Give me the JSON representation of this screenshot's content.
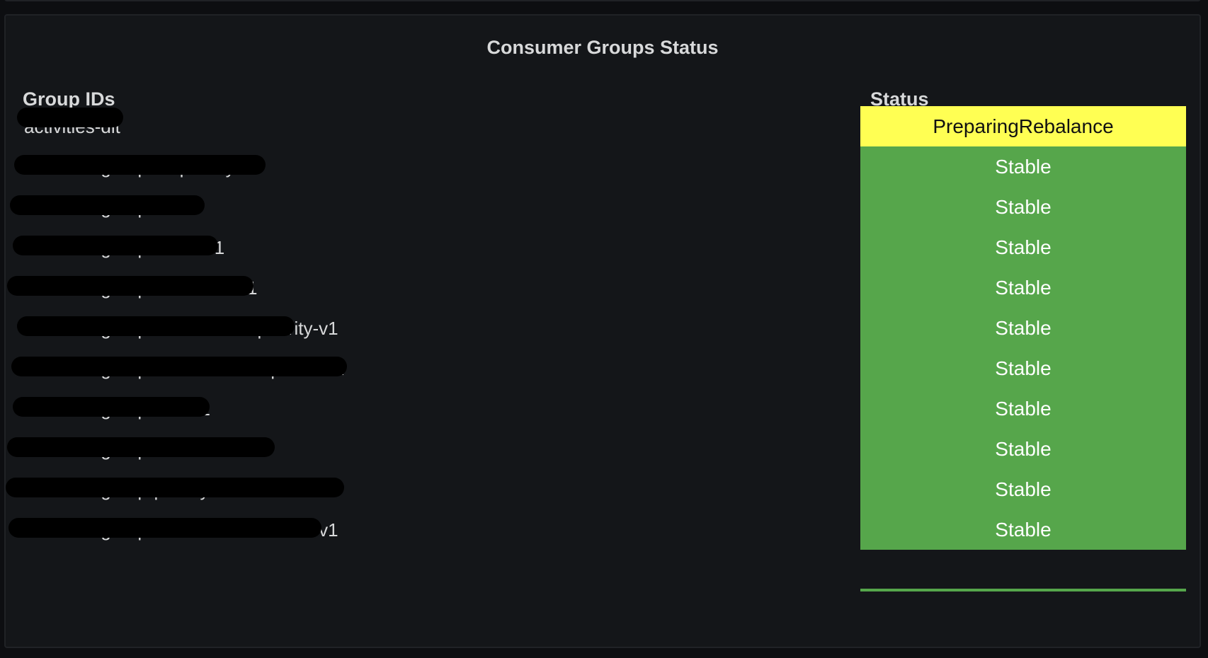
{
  "panel": {
    "title": "Consumer Groups Status"
  },
  "columns": {
    "group_ids": "Group IDs",
    "status": "Status"
  },
  "colors": {
    "stable": "#56a64b",
    "preparing_rebalance": "#ffff53",
    "background": "#141619",
    "text": "#d8d9da"
  },
  "rows": [
    {
      "group_id": "activities-dlt",
      "status": "PreparingRebalance",
      "status_color": "#ffff53",
      "status_text_color": "#111111"
    },
    {
      "group_id": "activities-group-dlt-priority-v1",
      "status": "Stable",
      "status_color": "#56a64b",
      "status_text_color": "#ffffff"
    },
    {
      "group_id": "activities-group-dlt-v1",
      "status": "Stable",
      "status_color": "#56a64b",
      "status_text_color": "#ffffff"
    },
    {
      "group_id": "activities-group-alerts-v1",
      "status": "Stable",
      "status_color": "#56a64b",
      "status_text_color": "#ffffff"
    },
    {
      "group_id": "activities-group-userflows-v1",
      "status": "Stable",
      "status_color": "#56a64b",
      "status_text_color": "#ffffff"
    },
    {
      "group_id": "activities-group-notifications-priority-v1",
      "status": "Stable",
      "status_color": "#56a64b",
      "status_text_color": "#ffffff"
    },
    {
      "group_id": "activities-group-notification-requests-v1",
      "status": "Stable",
      "status_color": "#56a64b",
      "status_text_color": "#ffffff"
    },
    {
      "group_id": "activities-group-rain-v1",
      "status": "Stable",
      "status_color": "#56a64b",
      "status_text_color": "#ffffff"
    },
    {
      "group_id": "activities-group-socialflows-v1",
      "status": "Stable",
      "status_color": "#56a64b",
      "status_text_color": "#ffffff"
    },
    {
      "group_id": "activities-group-priority-notifications-v1",
      "status": "Stable",
      "status_color": "#56a64b",
      "status_text_color": "#ffffff"
    },
    {
      "group_id": "activities-group-scheduler-for-users-v1",
      "status": "Stable",
      "status_color": "#56a64b",
      "status_text_color": "#ffffff"
    }
  ]
}
